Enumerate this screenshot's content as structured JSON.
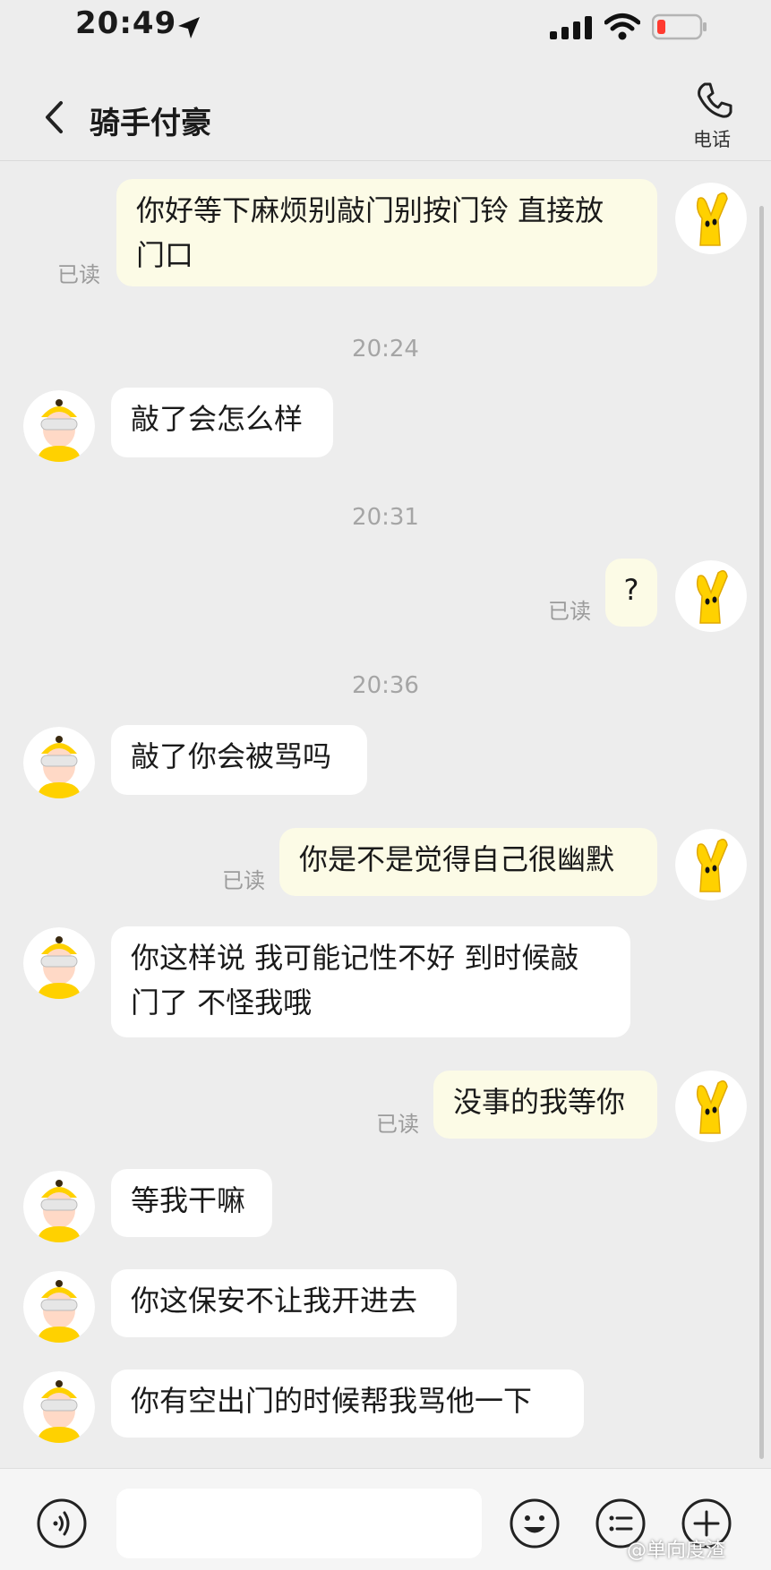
{
  "status_bar": {
    "time": "20:49"
  },
  "header": {
    "title": "骑手付豪",
    "call_label": "电话"
  },
  "messages": [
    {
      "text": "你好等下麻烦别敲门别按门铃 直接放\n门口",
      "read": "已读"
    },
    {
      "timestamp": "20:24"
    },
    {
      "text": "敲了会怎么样"
    },
    {
      "timestamp": "20:31"
    },
    {
      "text": "?",
      "read": "已读"
    },
    {
      "timestamp": "20:36"
    },
    {
      "text": "敲了你会被骂吗"
    },
    {
      "text": "你是不是觉得自己很幽默",
      "read": "已读"
    },
    {
      "text": "你这样说 我可能记性不好 到时候敲\n门了 不怪我哦"
    },
    {
      "text": "没事的我等你",
      "read": "已读"
    },
    {
      "text": "等我干嘛"
    },
    {
      "text": "你这保安不让我开进去"
    },
    {
      "text": "你有空出门的时候帮我骂他一下"
    }
  ],
  "input": {
    "value": ""
  },
  "watermark": "@单向度渣",
  "colors": {
    "background": "#ededed",
    "outgoing_bubble": "#fcfbe6",
    "incoming_bubble": "#ffffff",
    "avatar_yellow": "#ffd100"
  },
  "icons": [
    "location-arrow-icon",
    "signal-icon",
    "wifi-icon",
    "battery-low-icon",
    "back-chevron-icon",
    "phone-icon",
    "voice-icon",
    "emoji-icon",
    "list-icon",
    "plus-icon"
  ]
}
